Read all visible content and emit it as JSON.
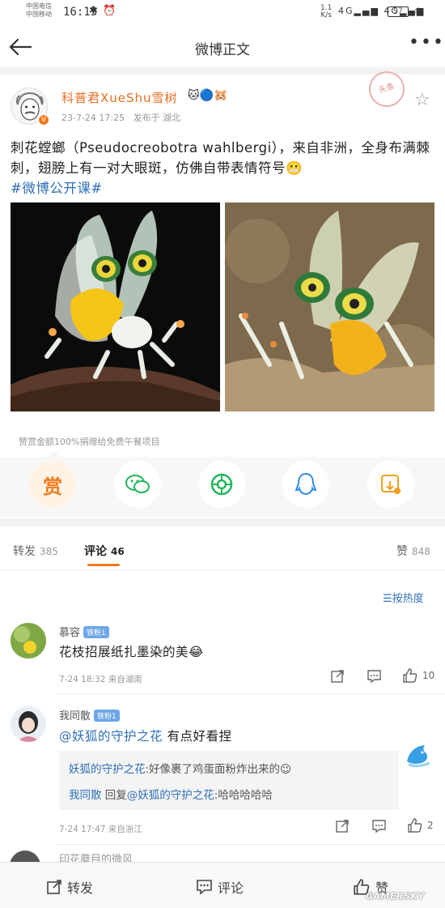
{
  "status_bar": {
    "carrier_1": "中国电信",
    "carrier_2": "中国移动",
    "time": "16:13",
    "system_icons": "✱ ⏰",
    "net_speed_top": "1.1",
    "net_speed_bottom": "K/s",
    "signal_1": "4G",
    "signal_2": "4G",
    "battery": "97"
  },
  "nav": {
    "title": "微博正文"
  },
  "post": {
    "username": "科普君XueShu雪树",
    "badges": "🐱🔵🐹",
    "time": "23-7-24 17:25",
    "location": "发布于 湖北",
    "stamp_text": "头条",
    "text": "刺花螳螂（Pseudocreobotra wahlbergi），来自非洲，全身布满棘刺，翅膀上有一对大眼斑，仿佛自带表情符号😬",
    "topic": "#微博公开课#"
  },
  "donate": {
    "text": "赞赏金额100%捐赠给免费午餐项目",
    "reward_label": "赏"
  },
  "tabs": [
    {
      "label": "转发",
      "count": "385"
    },
    {
      "label": "评论",
      "count": "46"
    },
    {
      "label": "赞",
      "count": "848"
    }
  ],
  "sort_label": "按热度",
  "comments": [
    {
      "name": "慕容",
      "fans": "铁粉1",
      "text": "花枝招展纸扎墨染的美😂",
      "meta": "7-24 18:32  来自湖南",
      "likes": "10"
    },
    {
      "name": "我同散",
      "fans": "铁粉1",
      "mention": "@妖狐的守护之花",
      "text": " 有点好看捏",
      "meta": "7-24 17:47  来自浙江",
      "likes": "2",
      "replies": [
        {
          "name": "妖狐的守护之花",
          "text": ":好像裹了鸡蛋面粉炸出来的😉"
        },
        {
          "name": "我同散",
          "mid": " 回复",
          "target": "@妖狐的守护之花",
          "text": ":哈哈哈哈哈"
        }
      ]
    }
  ],
  "next_comment_partial": "印花蘑目的微风",
  "bottom_bar": {
    "repost": "转发",
    "comment": "评论",
    "like": "赞"
  },
  "watermark": "GAMERSKY",
  "colors": {
    "accent": "#f07b1b",
    "link": "#2f6fb7"
  }
}
